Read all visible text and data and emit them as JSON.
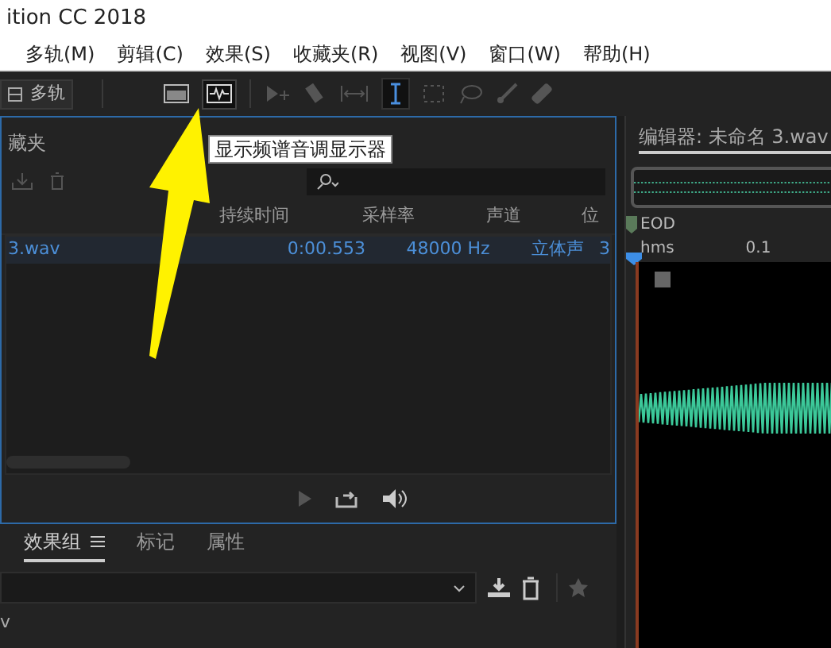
{
  "window": {
    "title": "ition CC 2018"
  },
  "menu": [
    "多轨(M)",
    "剪辑(C)",
    "效果(S)",
    "收藏夹(R)",
    "视图(V)",
    "窗口(W)",
    "帮助(H)"
  ],
  "toolbar": {
    "workspace_button": "多轨",
    "tooltip": "显示频谱音调显示器"
  },
  "files_panel": {
    "title": "藏夹",
    "columns": [
      "持续时间",
      "采样率",
      "声道",
      "位"
    ],
    "rows": [
      {
        "name": "3.wav",
        "duration": "0:00.553",
        "sample_rate": "48000 Hz",
        "channels": "立体声",
        "column_5": "3",
        "selected": true
      }
    ]
  },
  "bottom_panel": {
    "tabs": [
      {
        "label": "效果组",
        "selected": true
      },
      {
        "label": "标记",
        "selected": false
      },
      {
        "label": "属性",
        "selected": false
      }
    ],
    "row_text": "v"
  },
  "editor": {
    "title": "编辑器: 未命名 3.wav",
    "marker": "EOD",
    "ruler": [
      "hms",
      "0.1"
    ]
  }
}
